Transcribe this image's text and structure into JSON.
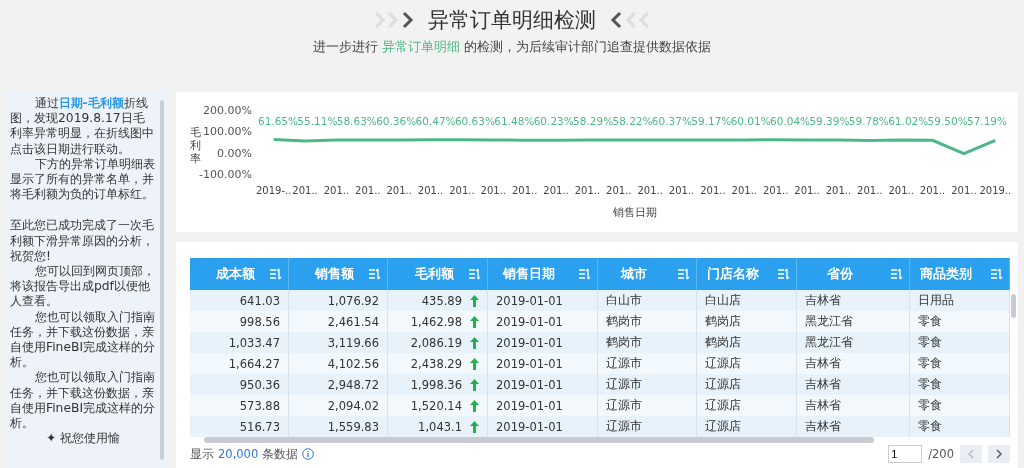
{
  "header": {
    "title": "异常订单明细检测",
    "subtitle_before": "进一步进行 ",
    "subtitle_highlight": "异常订单明细",
    "subtitle_after": " 的检测，为后续审计部门追查提供数据依据"
  },
  "sidebar": {
    "paragraphs": [
      {
        "kind": "indented",
        "lead": "通过",
        "link": "日期-毛利额",
        "text": "折线图，发现2019.8.17日毛利率异常明显，在折线图中点击该日期进行联动。"
      },
      {
        "kind": "indented",
        "text": "下方的异常订单明细表显示了所有的异常名单，并将毛利额为负的订单标红。"
      },
      {
        "kind": "spaced",
        "text": "至此您已成功完成了一次毛利额下滑异常原因的分析，祝贺您!"
      },
      {
        "kind": "indented",
        "text": "您可以回到网页顶部，将该报告导出成pdf以便他人查看。"
      },
      {
        "kind": "indented",
        "text": "您也可以领取入门指南任务，并下载这份数据，亲自使用FineBI完成这样的分析。"
      },
      {
        "kind": "indented",
        "text": "您也可以领取入门指南任务，并下载这份数据，亲自使用FineBI完成这样的分析。"
      },
      {
        "kind": "closing",
        "text": "✦ 祝您使用愉"
      }
    ]
  },
  "chart": {
    "chart_data": {
      "type": "line",
      "xlabel": "销售日期",
      "ylabel": "毛利率",
      "ylim": [
        -1,
        2
      ],
      "yticks": [
        {
          "value": -1,
          "label": "-100.00%"
        },
        {
          "value": 0,
          "label": "0.00%"
        },
        {
          "value": 1,
          "label": "100.00%"
        },
        {
          "value": 2,
          "label": "200.00%"
        }
      ],
      "categories": [
        "2019-..",
        "201..",
        "201..",
        "201..",
        "201..",
        "201..",
        "201..",
        "201..",
        "201..",
        "201..",
        "201..",
        "201..",
        "201..",
        "201..",
        "201..",
        "201..",
        "201..",
        "201..",
        "201..",
        "201..",
        "201..",
        "201..",
        "201..",
        "2019.."
      ],
      "series": [
        {
          "color": "#4cb886",
          "values": [
            0.62,
            0.55,
            0.59,
            0.6,
            0.6,
            0.61,
            0.61,
            0.6,
            0.58,
            0.58,
            0.6,
            0.59,
            0.6,
            0.6,
            0.59,
            0.6,
            0.61,
            0.6,
            0.59,
            0.57,
            0.6,
            0.58,
            -0.05,
            0.58
          ]
        }
      ],
      "annotations": [
        "61.65%",
        "55.11%",
        "58.63%",
        "60.36%",
        "60.47%",
        "60.63%",
        "61.48%",
        "60.23%",
        "58.29%",
        "58.22%",
        "60.37%",
        "59.17%",
        "60.01%",
        "60.04%",
        "59.39%",
        "59.78%",
        "61.02%",
        "59.50%",
        "57.19%"
      ]
    }
  },
  "table": {
    "columns": [
      "成本额",
      "销售额",
      "毛利额",
      "销售日期",
      "城市",
      "门店名称",
      "省份",
      "商品类别"
    ],
    "rows": [
      {
        "rising": true,
        "cells": [
          "641.03",
          "1,076.92",
          "435.89",
          "2019-01-01",
          "白山市",
          "白山店",
          "吉林省",
          "日用品"
        ]
      },
      {
        "rising": true,
        "cells": [
          "998.56",
          "2,461.54",
          "1,462.98",
          "2019-01-01",
          "鹤岗市",
          "鹤岗店",
          "黑龙江省",
          "零食"
        ]
      },
      {
        "rising": true,
        "cells": [
          "1,033.47",
          "3,119.66",
          "2,086.19",
          "2019-01-01",
          "鹤岗市",
          "鹤岗店",
          "黑龙江省",
          "零食"
        ]
      },
      {
        "rising": true,
        "cells": [
          "1,664.27",
          "4,102.56",
          "2,438.29",
          "2019-01-01",
          "辽源市",
          "辽源店",
          "吉林省",
          "零食"
        ]
      },
      {
        "rising": true,
        "cells": [
          "950.36",
          "2,948.72",
          "1,998.36",
          "2019-01-01",
          "辽源市",
          "辽源店",
          "吉林省",
          "零食"
        ]
      },
      {
        "rising": true,
        "cells": [
          "573.88",
          "2,094.02",
          "1,520.14",
          "2019-01-01",
          "辽源市",
          "辽源店",
          "吉林省",
          "零食"
        ]
      },
      {
        "rising": true,
        "cells": [
          "516.73",
          "1,559.83",
          "1,043.1",
          "2019-01-01",
          "辽源市",
          "辽源店",
          "吉林省",
          "零食"
        ]
      }
    ],
    "footer": {
      "prefix": "显示",
      "count": "20,000",
      "suffix": "条数据",
      "page": "1",
      "total": "/200"
    }
  }
}
